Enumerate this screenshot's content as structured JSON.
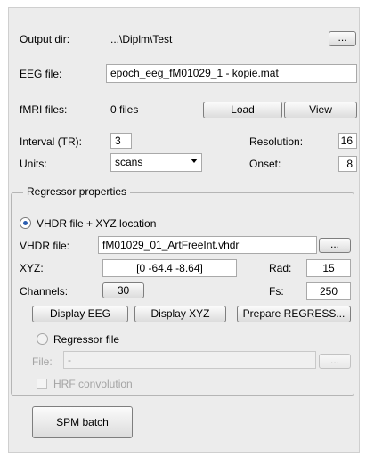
{
  "output_dir": {
    "label": "Output dir:",
    "value": "...\\Diplm\\Test",
    "browse_label": "..."
  },
  "eeg_file": {
    "label": "EEG file:",
    "value": "epoch_eeg_fM01029_1 - kopie.mat"
  },
  "fmri_files": {
    "label": "fMRI files:",
    "value": "0 files",
    "load_label": "Load",
    "view_label": "View"
  },
  "interval": {
    "label": "Interval (TR):",
    "value": "3"
  },
  "resolution": {
    "label": "Resolution:",
    "value": "16"
  },
  "units": {
    "label": "Units:",
    "value": "scans"
  },
  "onset": {
    "label": "Onset:",
    "value": "8"
  },
  "regressor": {
    "title": "Regressor properties",
    "vhdr_option": "VHDR file + XYZ location",
    "vhdr_file_label": "VHDR file:",
    "vhdr_file_value": "fM01029_01_ArtFreeInt.vhdr",
    "vhdr_browse_label": "...",
    "xyz_label": "XYZ:",
    "xyz_value": "[0 -64.4 -8.64]",
    "rad_label": "Rad:",
    "rad_value": "15",
    "channels_label": "Channels:",
    "channels_value": "30",
    "fs_label": "Fs:",
    "fs_value": "250",
    "display_eeg_label": "Display EEG",
    "display_xyz_label": "Display XYZ",
    "prepare_label": "Prepare REGRESS...",
    "regressor_file_option": "Regressor file",
    "file_label": "File:",
    "file_value": "-",
    "file_browse_label": "...",
    "hrf_label": "HRF convolution"
  },
  "spm_batch_label": "SPM batch"
}
